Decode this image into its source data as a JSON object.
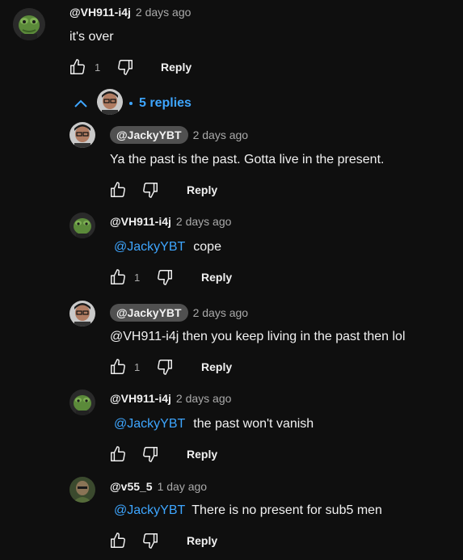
{
  "top_comment": {
    "handle": "@VH911-i4j",
    "time": "2 days ago",
    "text": "it's over",
    "like_count": "1",
    "reply_label": "Reply"
  },
  "replies_toggle": {
    "label": "5 replies",
    "chevron_icon": "chevron-up-icon"
  },
  "replies": [
    {
      "handle": "@JackyYBT",
      "time": "2 days ago",
      "mention": "",
      "text": "Ya the past is the past. Gotta live in the present.",
      "like_count": "",
      "reply_label": "Reply"
    },
    {
      "handle": "@VH911-i4j",
      "time": "2 days ago",
      "mention": "@JackyYBT",
      "text": "cope",
      "like_count": "1",
      "reply_label": "Reply"
    },
    {
      "handle": "@JackyYBT",
      "time": "2 days ago",
      "mention": "",
      "text": "@VH911-i4j then you keep living in the past then lol",
      "like_count": "1",
      "reply_label": "Reply"
    },
    {
      "handle": "@VH911-i4j",
      "time": "2 days ago",
      "mention": "@JackyYBT",
      "text": "the past won't vanish",
      "like_count": "",
      "reply_label": "Reply"
    },
    {
      "handle": "@v55_5",
      "time": "1 day ago",
      "mention": "@JackyYBT",
      "text": "There is no present for sub5 men",
      "like_count": "",
      "reply_label": "Reply"
    }
  ],
  "colors": {
    "background": "#0f0f0f",
    "link": "#3ea6ff",
    "chip": "#505050",
    "muted": "#aaaaaa"
  }
}
